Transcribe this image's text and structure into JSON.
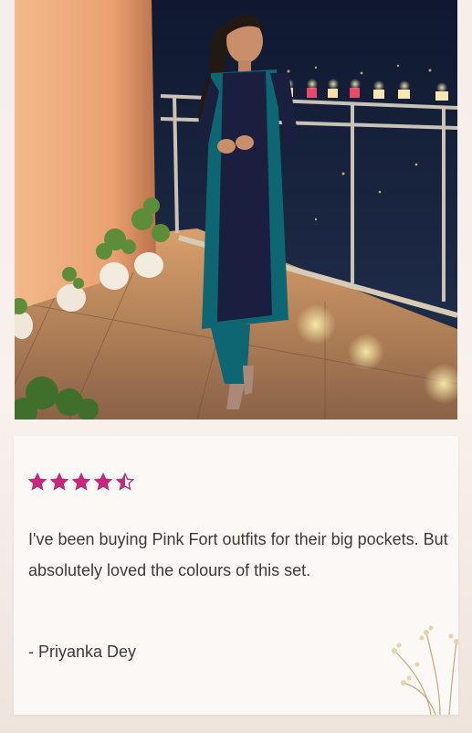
{
  "review": {
    "rating": 4.5,
    "rating_max": 5,
    "star_color": "#c22a7b",
    "text": "I've been buying Pink Fort outfits for their big pockets. But absolutely loved the colours of this set.",
    "author": "- Priyanka Dey"
  },
  "colors": {
    "text": "#3b3b3b",
    "card_background": "#fbf8f6"
  }
}
